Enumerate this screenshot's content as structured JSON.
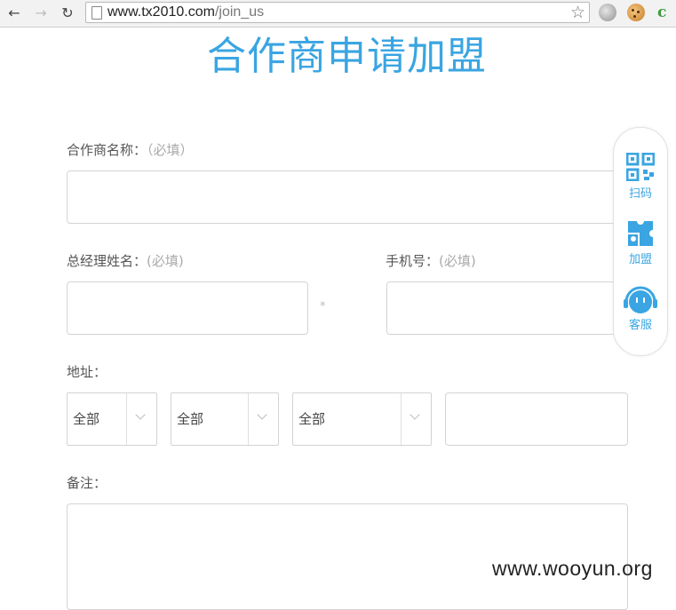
{
  "browser": {
    "url_host": "www.tx2010.com",
    "url_path": "/join_us",
    "extension_c": "c"
  },
  "page": {
    "title": "合作商申请加盟"
  },
  "form": {
    "partner_name_label": "合作商名称：",
    "partner_name_required": "（必填）",
    "manager_label": "总经理姓名：",
    "manager_required": "(必填)",
    "phone_label": "手机号：",
    "phone_required": "(必填)",
    "asterisk": "*",
    "address_label": "地址：",
    "province_value": "全部",
    "city_value": "全部",
    "district_value": "全部",
    "remark_label": "备注："
  },
  "float_panel": {
    "scan_label": "扫码",
    "join_label": "加盟",
    "service_label": "客服"
  },
  "watermark": "www.wooyun.org",
  "colors": {
    "accent": "#3aa5e2",
    "label": "#555555",
    "placeholder": "#aaaaaa",
    "border": "#d3d3d3"
  }
}
